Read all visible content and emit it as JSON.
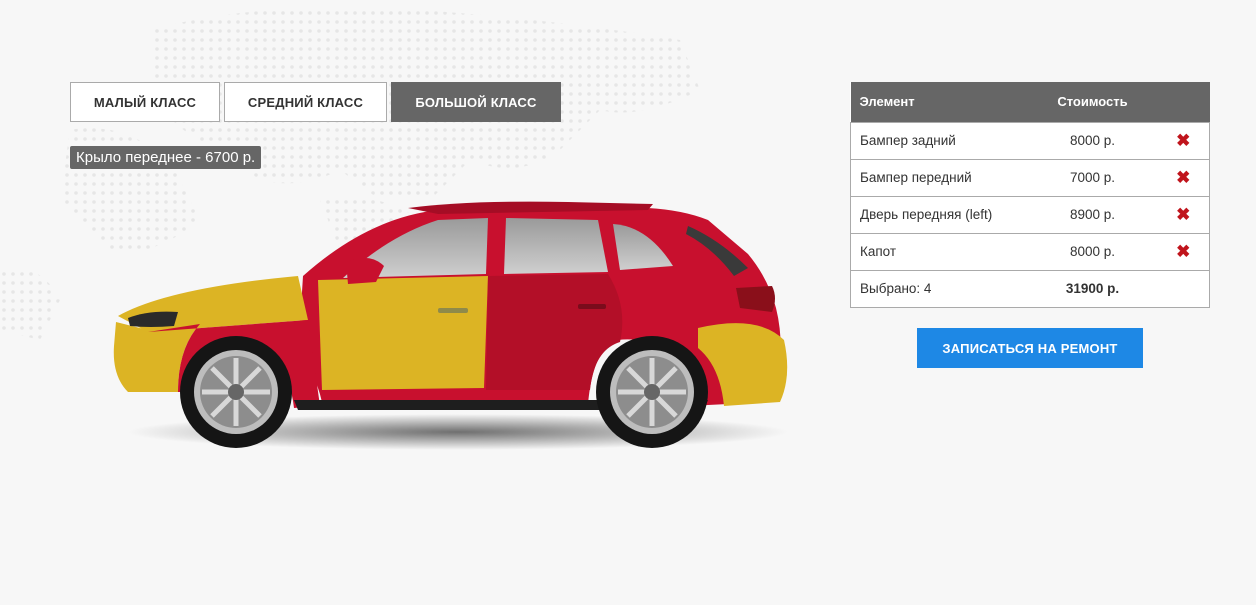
{
  "classes": [
    {
      "label": "МАЛЫЙ КЛАСС",
      "active": false
    },
    {
      "label": "СРЕДНИЙ КЛАСС",
      "active": false
    },
    {
      "label": "БОЛЬШОЙ КЛАСС",
      "active": true
    }
  ],
  "hover_tooltip": "Крыло переднее - 6700 р.",
  "colors": {
    "body": "#c8102e",
    "selected": "#dcb424",
    "active_tab": "#666666",
    "cta": "#1e88e5",
    "delete": "#c0141c"
  },
  "summary": {
    "header": {
      "element": "Элемент",
      "cost": "Стоимость"
    },
    "rows": [
      {
        "element": "Бампер задний",
        "cost": "8000 р.",
        "remove_icon": "close-x-icon"
      },
      {
        "element": "Бампер передний",
        "cost": "7000 р.",
        "remove_icon": "close-x-icon"
      },
      {
        "element": "Дверь передняя (left)",
        "cost": "8900 р.",
        "remove_icon": "close-x-icon"
      },
      {
        "element": "Капот",
        "cost": "8000 р.",
        "remove_icon": "close-x-icon"
      }
    ],
    "footer": {
      "selected": "Выбрано: 4",
      "total": "31900 р."
    }
  },
  "cta_label": "ЗАПИСАТЬСЯ НА РЕМОНТ"
}
